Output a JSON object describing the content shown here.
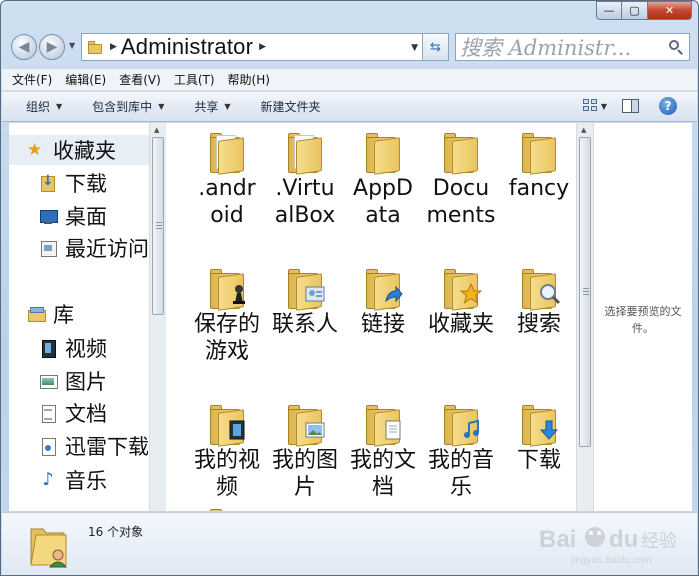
{
  "window": {
    "min_label": "—",
    "max_label": "▢",
    "close_label": "✕"
  },
  "address": {
    "path": "Administrator",
    "search_placeholder": "搜索 Administr..."
  },
  "menu": [
    {
      "label": "文件(F)"
    },
    {
      "label": "编辑(E)"
    },
    {
      "label": "查看(V)"
    },
    {
      "label": "工具(T)"
    },
    {
      "label": "帮助(H)"
    }
  ],
  "toolbar": {
    "organize": "组织",
    "include_library": "包含到库中",
    "share": "共享",
    "new_folder": "新建文件夹",
    "help": "?"
  },
  "nav": {
    "favorites": "收藏夹",
    "downloads": "下载",
    "desktop": "桌面",
    "recent": "最近访问的位置",
    "libraries": "库",
    "videos": "视频",
    "pictures": "图片",
    "documents": "文档",
    "xunlei": "迅雷下载",
    "music": "音乐"
  },
  "files": [
    {
      "name": ".android",
      "script": "latin",
      "badge": "paper"
    },
    {
      "name": ".VirtualBox",
      "script": "latin",
      "badge": "paper"
    },
    {
      "name": "AppData",
      "script": "latin",
      "badge": "none"
    },
    {
      "name": "Documents",
      "script": "latin",
      "badge": "none"
    },
    {
      "name": "fancy",
      "script": "latin",
      "badge": "none"
    },
    {
      "name": "保存的游戏",
      "script": "cjk",
      "badge": "chess"
    },
    {
      "name": "联系人",
      "script": "cjk",
      "badge": "contact"
    },
    {
      "name": "链接",
      "script": "cjk",
      "badge": "link"
    },
    {
      "name": "收藏夹",
      "script": "cjk",
      "badge": "star"
    },
    {
      "name": "搜索",
      "script": "cjk",
      "badge": "search"
    },
    {
      "name": "我的视频",
      "script": "cjk",
      "badge": "video"
    },
    {
      "name": "我的图片",
      "script": "cjk",
      "badge": "picture"
    },
    {
      "name": "我的文档",
      "script": "cjk",
      "badge": "document"
    },
    {
      "name": "我的音乐",
      "script": "cjk",
      "badge": "music"
    },
    {
      "name": "下载",
      "script": "cjk",
      "badge": "download"
    }
  ],
  "preview": {
    "text": "选择要预览的文件。"
  },
  "status": {
    "count": "16 个对象"
  },
  "colors": {
    "folder": "#e9c560",
    "accent": "#2b6fcf",
    "close": "#c2462c"
  }
}
